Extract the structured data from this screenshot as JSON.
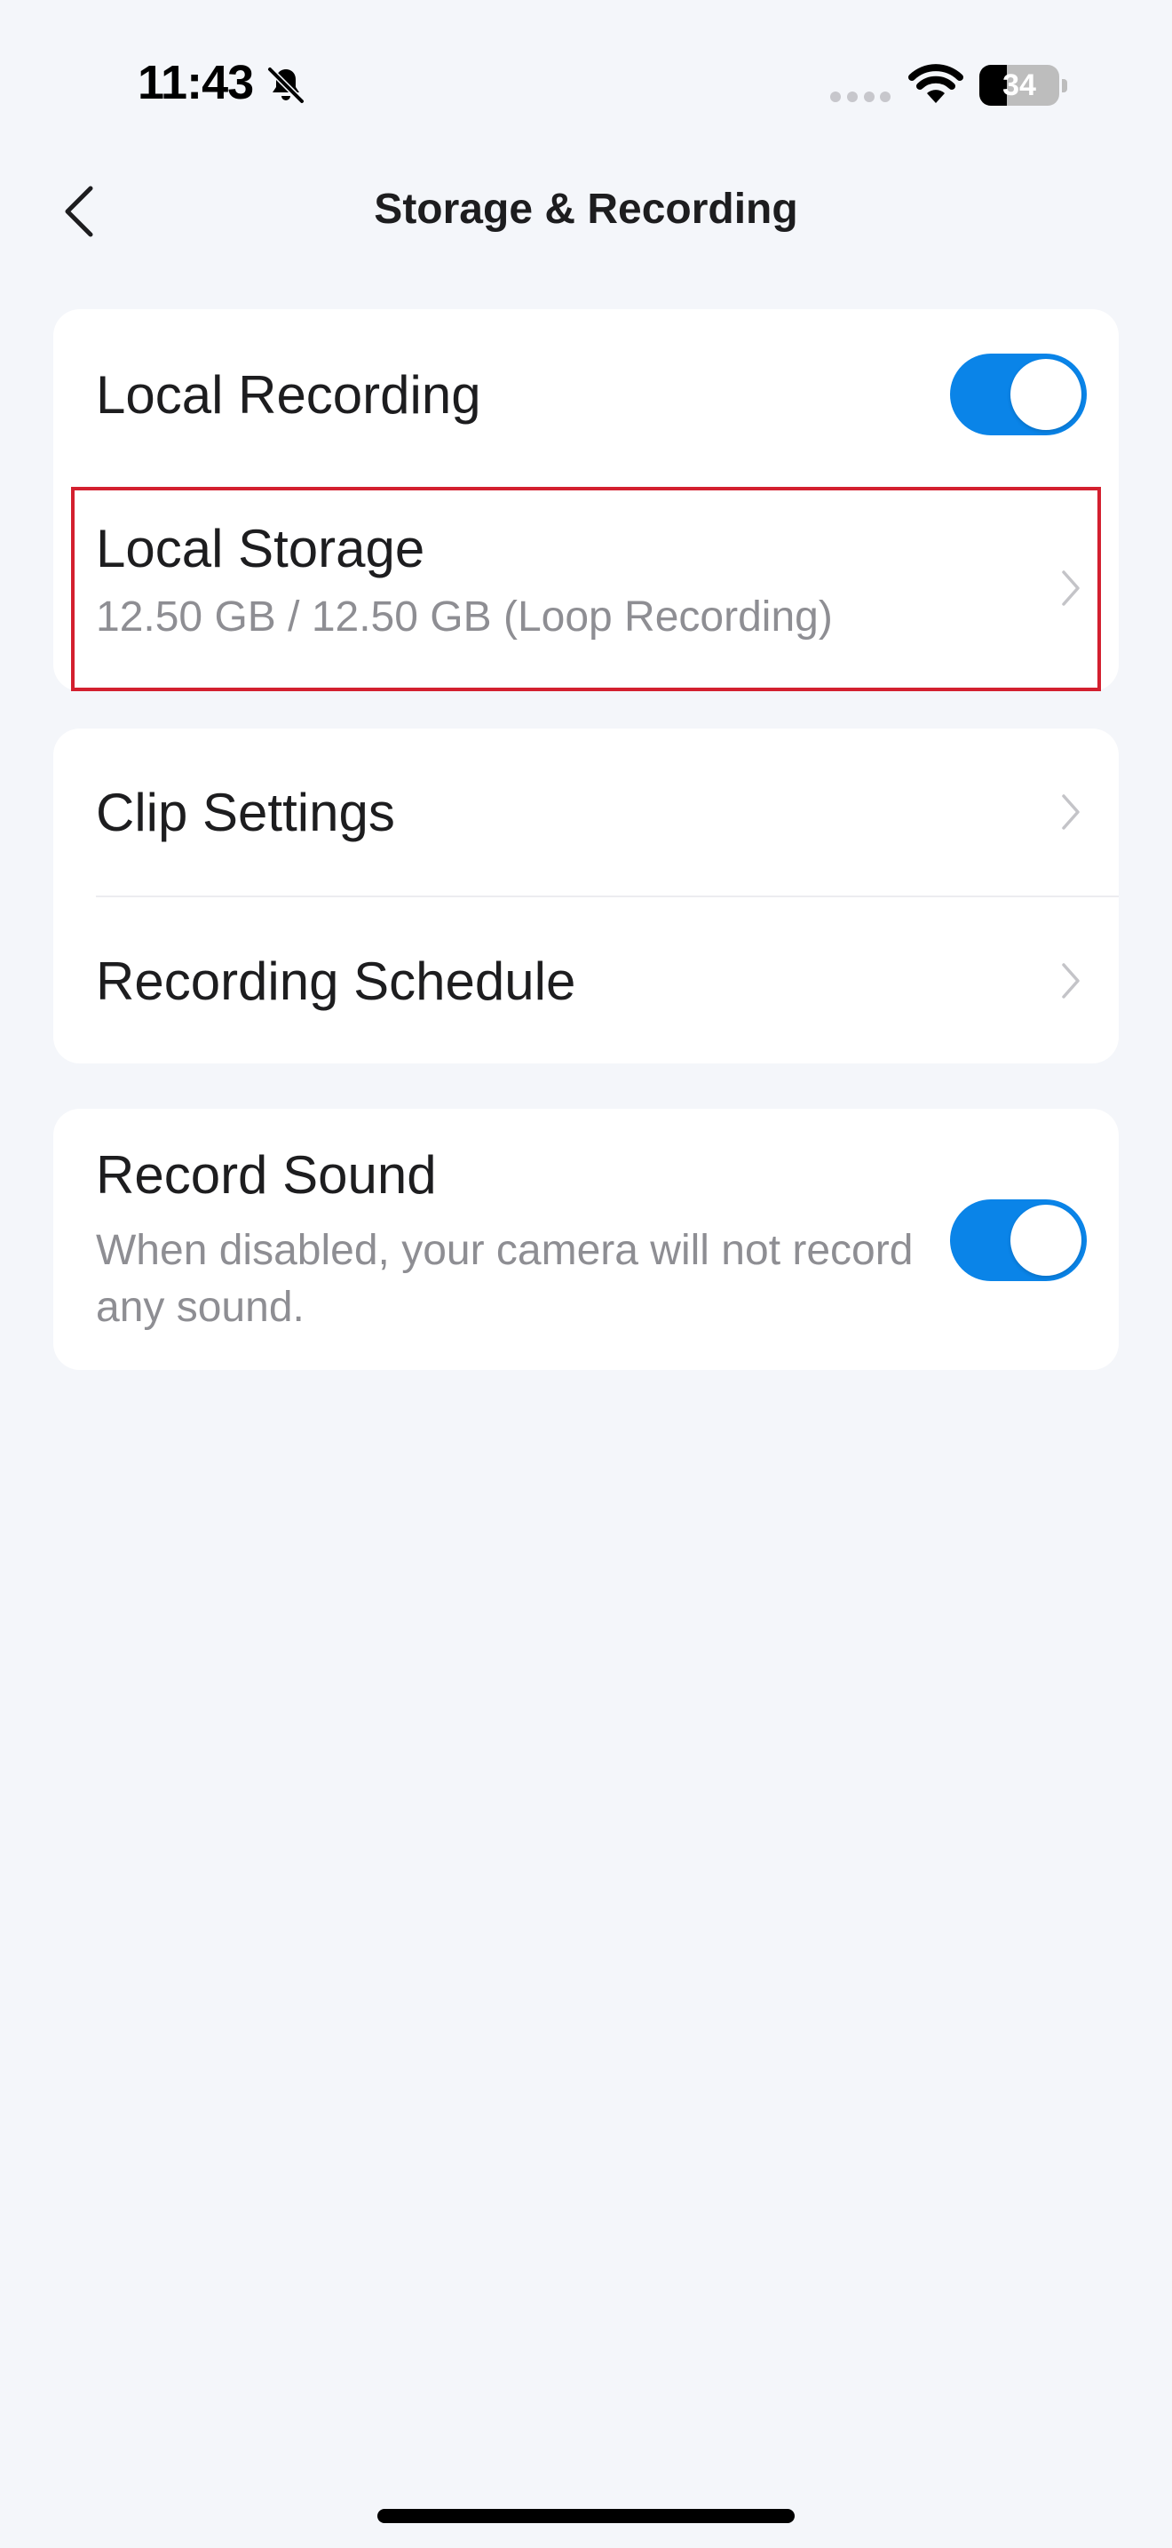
{
  "status_bar": {
    "time": "11:43",
    "battery_level": "34",
    "battery_fraction": 0.34,
    "icons": [
      "bell-slash-icon",
      "cellular-dots-icon",
      "wifi-icon",
      "battery-icon"
    ]
  },
  "nav": {
    "back_icon": "chevron-left-icon",
    "title": "Storage & Recording"
  },
  "sections": {
    "recording": {
      "local_recording": {
        "label": "Local Recording",
        "enabled": true
      },
      "local_storage": {
        "label": "Local Storage",
        "detail": "12.50 GB / 12.50 GB (Loop Recording)",
        "icon": "chevron-right-icon"
      }
    },
    "settings": {
      "clip_settings": {
        "label": "Clip Settings",
        "icon": "chevron-right-icon"
      },
      "recording_schedule": {
        "label": "Recording Schedule",
        "icon": "chevron-right-icon"
      }
    },
    "sound": {
      "record_sound": {
        "label": "Record Sound",
        "description": "When disabled, your camera will not record any sound.",
        "enabled": true
      }
    }
  },
  "colors": {
    "background": "#f4f6fa",
    "card": "#ffffff",
    "toggle_on": "#0a84e8",
    "highlight": "#d3202f",
    "secondary_text": "#8e8e93"
  }
}
